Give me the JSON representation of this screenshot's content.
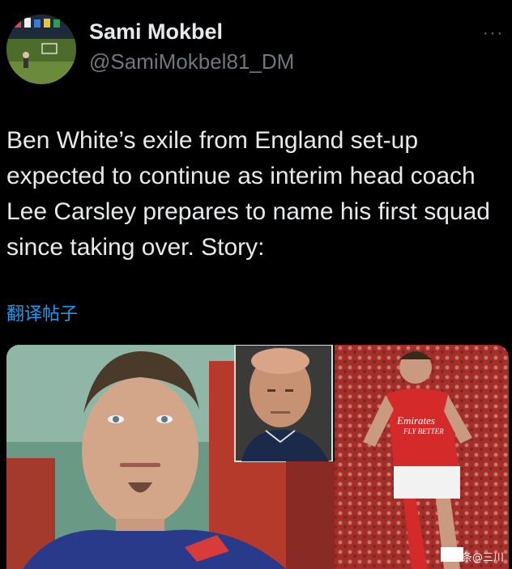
{
  "author": {
    "display_name": "Sami Mokbel",
    "handle": "@SamiMokbel81_DM",
    "avatar_icon": "avatar-photo-football-pitch"
  },
  "more_button": {
    "label": "···",
    "icon": "more-horizontal-icon"
  },
  "tweet": {
    "text": "Ben White’s exile from England set-up expected to continue as interim head coach Lee Carsley prepares to name his first squad since taking over. Story:",
    "translate_label": "翻译帖子"
  },
  "media": {
    "panels": [
      "ben-white-portrait",
      "lee-carsley-inset",
      "player-in-arsenal-kit"
    ],
    "shirt_sponsor_line1": "Emirates",
    "shirt_sponsor_line2": "FLY BETTER",
    "watermark_text": "头条@三川"
  },
  "colors": {
    "background": "#000000",
    "text": "#e7e9ea",
    "secondary": "#71767b",
    "link": "#1d9bf0"
  }
}
